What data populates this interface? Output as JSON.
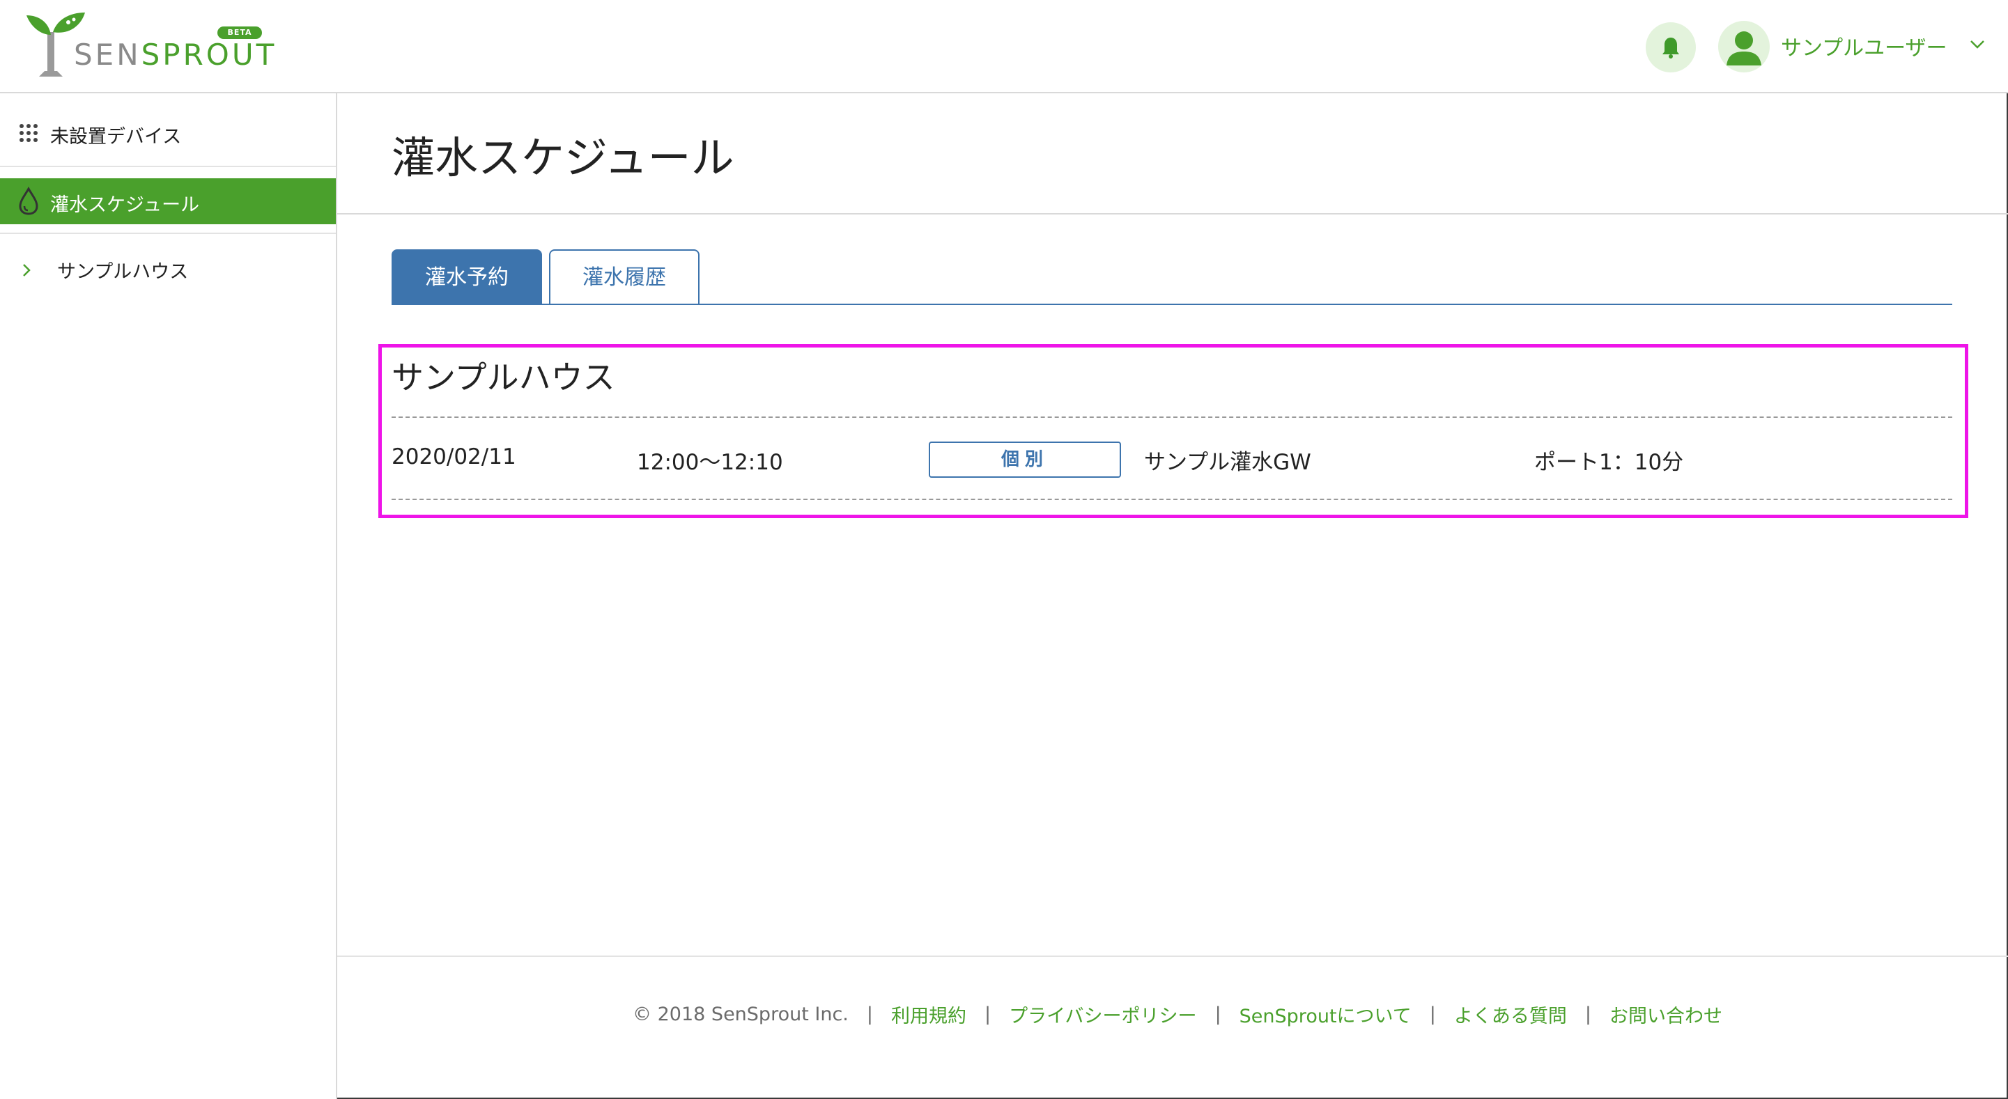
{
  "header": {
    "logo_text_prefix": "SEN",
    "logo_text_suffix": "SPROUT",
    "beta_badge": "BETA",
    "user_name": "サンプルユーザー"
  },
  "sidebar": {
    "items": [
      {
        "label": "未設置デバイス",
        "icon": "grid-icon"
      },
      {
        "label": "灌水スケジュール",
        "icon": "water-drop-icon",
        "active": true
      },
      {
        "label": "サンプルハウス",
        "icon": "chevron-right-icon"
      }
    ]
  },
  "main": {
    "title": "灌水スケジュール",
    "tabs": [
      {
        "label": "灌水予約",
        "active": true
      },
      {
        "label": "灌水履歴",
        "active": false
      }
    ],
    "schedule": {
      "house_name": "サンプルハウス",
      "rows": [
        {
          "date": "2020/02/11",
          "time": "12:00〜12:10",
          "type_badge": "個別",
          "gateway": "サンプル灌水GW",
          "port": "ポート1：10分"
        }
      ]
    }
  },
  "footer": {
    "copyright": "© 2018 SenSprout Inc.",
    "separator": "|",
    "links": [
      "利用規約",
      "プライバシーポリシー",
      "SenSproutについて",
      "よくある質問",
      "お問い合わせ"
    ]
  },
  "colors": {
    "brand_green": "#4aa02c",
    "tab_blue": "#3d74ad",
    "highlight_magenta": "#ee14e8",
    "bell_bg": "#e3f3dc"
  }
}
